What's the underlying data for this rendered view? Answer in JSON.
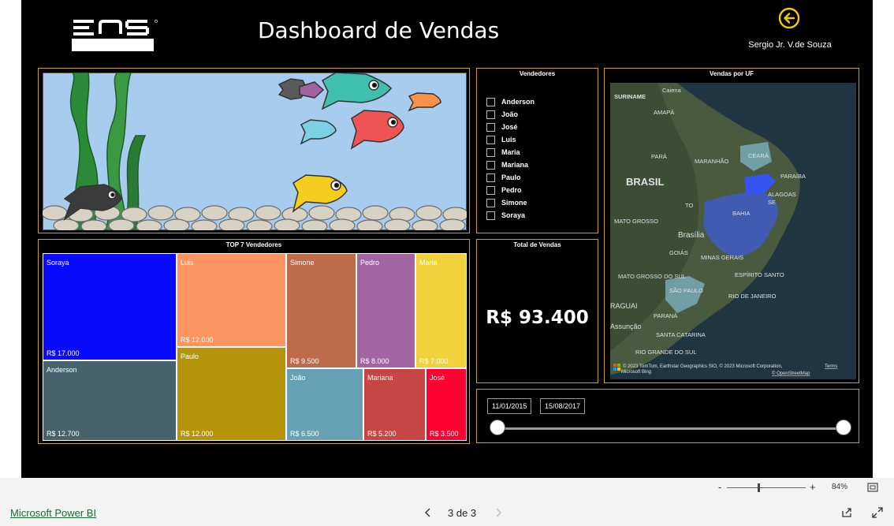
{
  "header": {
    "logo_text": "ENS",
    "title": "Dashboard de Vendas",
    "user_name": "Sergio Jr. V.de Souza",
    "back_icon": "arrow-left-circle-icon",
    "accent": "#f2c811"
  },
  "vendedores": {
    "title": "Vendedores",
    "items": [
      {
        "label": "Anderson"
      },
      {
        "label": "João"
      },
      {
        "label": "José"
      },
      {
        "label": "Luis"
      },
      {
        "label": "Maria"
      },
      {
        "label": "Mariana"
      },
      {
        "label": "Paulo"
      },
      {
        "label": "Pedro"
      },
      {
        "label": "Simone"
      },
      {
        "label": "Soraya"
      }
    ]
  },
  "treemap": {
    "title": "TOP 7 Vendedores",
    "cells": [
      {
        "name": "Soraya",
        "value": "R$ 17.000",
        "color": "#0a0aff"
      },
      {
        "name": "Anderson",
        "value": "R$ 12.700",
        "color": "#46626c"
      },
      {
        "name": "Luis",
        "value": "R$ 12.000",
        "color": "#fc9560"
      },
      {
        "name": "Paulo",
        "value": "R$ 12.000",
        "color": "#b69409"
      },
      {
        "name": "Simone",
        "value": "R$ 9.500",
        "color": "#bd6b4a"
      },
      {
        "name": "Pedro",
        "value": "R$ 8.000",
        "color": "#a364a3"
      },
      {
        "name": "Maria",
        "value": "R$ 7.000",
        "color": "#f2d23c"
      },
      {
        "name": "João",
        "value": "R$ 6.500",
        "color": "#65a1b2"
      },
      {
        "name": "Mariana",
        "value": "R$ 5.200",
        "color": "#c64545"
      },
      {
        "name": "José",
        "value": "R$ 3.500",
        "color": "#ff0033"
      }
    ]
  },
  "total": {
    "title": "Total de Vendas",
    "value": "R$ 93.400"
  },
  "map": {
    "title": "Vendas por UF",
    "labels": {
      "caiena": "Caiena",
      "suriname": "SURINAME",
      "amapa": "AMAPÁ",
      "para": "PARÁ",
      "maranhao": "MARANHÃO",
      "ceara": "CEARÁ",
      "paraiba": "PARAÍBA",
      "alagoas": "ALAGOAS",
      "se": "SE",
      "brasil": "BRASIL",
      "to": "TO",
      "bahia": "BAHIA",
      "mato_grosso": "MATO GROSSO",
      "brasilia": "Brasília",
      "goias": "GOIÁS",
      "minas_gerais": "MINAS GERAIS",
      "mato_grosso_do_sul": "MATO GROSSO DO SUL",
      "espirito_santo": "ESPÍRITO SANTO",
      "sao_paulo": "SÃO PAULO",
      "rio_de_janeiro": "RIO DE JANEIRO",
      "paraguai": "RAGUAI",
      "assuncao": "Assunção",
      "parana": "PARANÁ",
      "santa_catarina": "SANTA CATARINA",
      "rio_grande_do_sul": "RIO GRANDE DO SUL"
    },
    "attribution": "© 2023 TomTom, Earthstar Geographics SIO, © 2023 Microsoft Corporation,",
    "terms": "Terms",
    "osm": "© OpenStreetMap",
    "bing": "Microsoft Bing"
  },
  "date_slicer": {
    "start": "11/01/2015",
    "end": "15/08/2017"
  },
  "status_bar": {
    "zoom_minus": "-",
    "zoom_plus": "+",
    "zoom_level": "84%"
  },
  "footer": {
    "app_link": "Microsoft Power BI",
    "page_indicator": "3 de 3"
  }
}
